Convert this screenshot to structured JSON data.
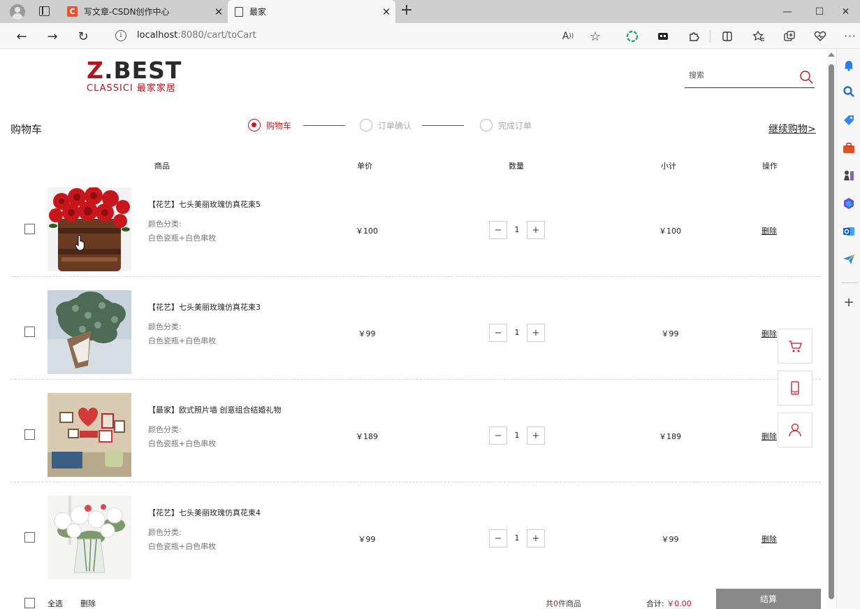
{
  "browser": {
    "tabs": [
      {
        "title": "写文章-CSDN创作中心",
        "favicon": "C",
        "active": false
      },
      {
        "title": "最家",
        "active": true
      }
    ],
    "new_tab": "+",
    "window_controls": {
      "minimize": "—",
      "maximize": "☐",
      "close": "✕"
    },
    "url_host": "localhost",
    "url_rest": ":8080/cart/toCart",
    "toolbar_icons": [
      "read-aloud-icon",
      "favorite-star-icon",
      "chatgpt-extension-icon",
      "collections-icon",
      "extensions-icon",
      "split-screen-icon",
      "favorites-icon",
      "collections-add-icon",
      "browser-essentials-icon",
      "more-icon"
    ],
    "sidebar_icons": [
      "bell-icon",
      "search-icon",
      "tag-icon",
      "briefcase-icon",
      "chess-icon",
      "microsoft365-icon",
      "outlook-icon",
      "send-icon",
      "add-icon"
    ]
  },
  "site": {
    "logo_main_z": "Z",
    "logo_main_rest": ".BEST",
    "logo_sub": "CLASSICI 最家家居",
    "search_placeholder": "搜索"
  },
  "cart": {
    "title": "购物车",
    "steps": [
      "购物车",
      "订单确认",
      "完成订单"
    ],
    "continue_shopping": "继续购物>",
    "headers": {
      "product": "商品",
      "unit_price": "单价",
      "quantity": "数量",
      "subtotal": "小计",
      "action": "操作"
    },
    "items": [
      {
        "name": "【花艺】七头美丽玫瑰仿真花束5",
        "attr_label": "颜色分类:",
        "attr_value": "白色瓷瓶+白色串枚",
        "price": "￥100",
        "qty": "1",
        "subtotal": "￥100",
        "delete": "删除"
      },
      {
        "name": "【花艺】七头美丽玫瑰仿真花束3",
        "attr_label": "颜色分类:",
        "attr_value": "白色瓷瓶+白色串枚",
        "price": "￥99",
        "qty": "1",
        "subtotal": "￥99",
        "delete": "删除"
      },
      {
        "name": "【最家】欧式照片墙 创意组合结婚礼物",
        "attr_label": "颜色分类:",
        "attr_value": "白色瓷瓶+白色串枚",
        "price": "￥189",
        "qty": "1",
        "subtotal": "￥189",
        "delete": "删除"
      },
      {
        "name": "【花艺】七头美丽玫瑰仿真花束4",
        "attr_label": "颜色分类:",
        "attr_value": "白色瓷瓶+白色串枚",
        "price": "￥99",
        "qty": "1",
        "subtotal": "￥99",
        "delete": "删除"
      }
    ],
    "qty_minus": "−",
    "qty_plus": "+",
    "footer": {
      "select_all": "全选",
      "delete": "删除",
      "count_prefix": "共",
      "count": "0",
      "count_suffix": "件商品",
      "total_label": "合计:",
      "total_amount": "￥0.00",
      "checkout": "结算"
    }
  },
  "colors": {
    "accent": "#c8161d",
    "checkout_bg": "#888888"
  },
  "floating_icons": [
    "cart-icon",
    "mobile-icon",
    "user-icon"
  ]
}
